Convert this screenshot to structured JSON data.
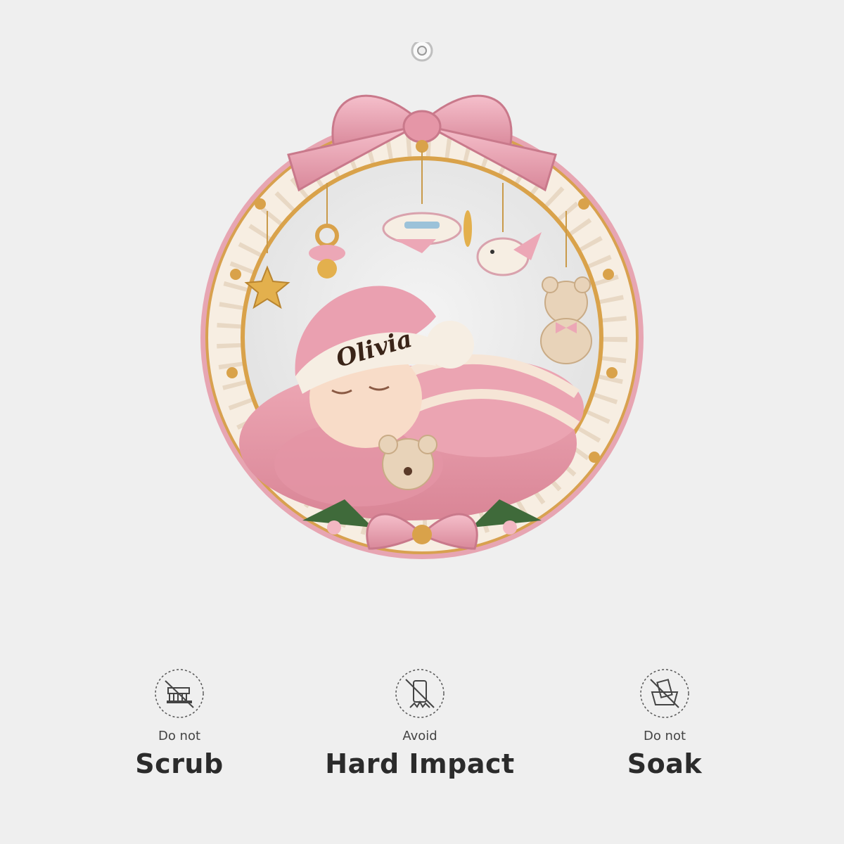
{
  "ornament": {
    "name_text": "Olivia"
  },
  "care": [
    {
      "icon": "no-scrub-icon",
      "sub": "Do not",
      "main": "Scrub"
    },
    {
      "icon": "no-impact-icon",
      "sub": "Avoid",
      "main": "Hard Impact"
    },
    {
      "icon": "no-soak-icon",
      "sub": "Do not",
      "main": "Soak"
    }
  ],
  "colors": {
    "background": "#efefef",
    "ribbon_pink": "#e9a0b0",
    "gold": "#d9a24a",
    "cream": "#f6eee3",
    "text_dark": "#2b2b2b"
  }
}
